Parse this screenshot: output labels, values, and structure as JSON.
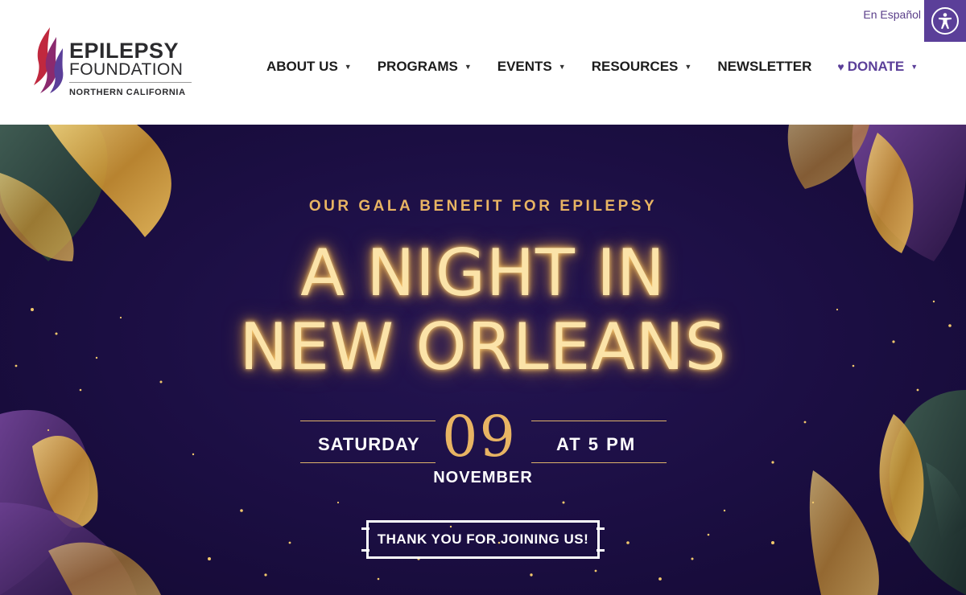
{
  "header": {
    "lang_link": "En Español",
    "logo": {
      "line1": "EPILEPSY",
      "line2": "FOUNDATION",
      "line3": "NORTHERN CALIFORNIA"
    },
    "nav": [
      {
        "label": "ABOUT US",
        "has_dropdown": true
      },
      {
        "label": "PROGRAMS",
        "has_dropdown": true
      },
      {
        "label": "EVENTS",
        "has_dropdown": true
      },
      {
        "label": "RESOURCES",
        "has_dropdown": true
      },
      {
        "label": "NEWSLETTER",
        "has_dropdown": false
      },
      {
        "label": "DONATE",
        "has_dropdown": true,
        "icon": "heart-icon"
      }
    ],
    "accessibility_icon": "accessibility-icon"
  },
  "hero": {
    "eyebrow": "OUR GALA BENEFIT FOR EPILEPSY",
    "title_line1": "A NIGHT IN",
    "title_line2": "NEW ORLEANS",
    "day": "SATURDAY",
    "date_number": "09",
    "time": "AT 5 PM",
    "month": "NOVEMBER",
    "cta": "THANK YOU FOR JOINING US!"
  },
  "colors": {
    "brand_purple": "#5b3f99",
    "hero_bg": "#1b0e42",
    "gold": "#e8b463",
    "glow_text": "#fbe3a8"
  }
}
